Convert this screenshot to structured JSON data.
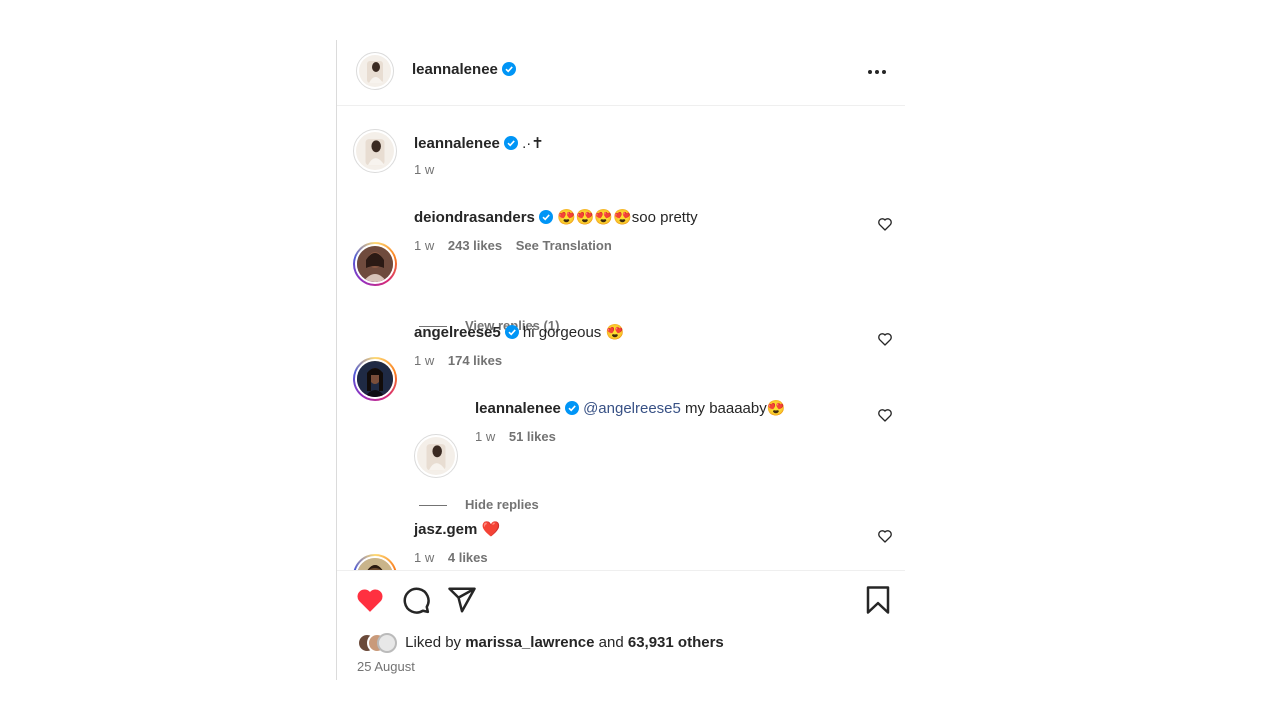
{
  "header": {
    "username": "leannalenee"
  },
  "caption": {
    "username": "leannalenee",
    "text": ".·✝",
    "time": "1 w"
  },
  "comments": [
    {
      "username": "deiondrasanders",
      "text": "😍😍😍😍soo pretty",
      "time": "1 w",
      "likes": "243 likes",
      "translate": "See Translation",
      "replies_label": "View replies (1)"
    },
    {
      "username": "angelreese5",
      "text": "hi gorgeous 😍",
      "time": "1 w",
      "likes": "174 likes"
    },
    {
      "username": "jasz.gem",
      "text": "❤️",
      "time": "1 w",
      "likes": "4 likes"
    }
  ],
  "reply": {
    "username": "leannalenee",
    "mention": "@angelreese5",
    "text": " my baaaaby😍",
    "time": "1 w",
    "likes": "51 likes",
    "hide_label": "Hide replies"
  },
  "footer": {
    "liked_prefix": "Liked by ",
    "liked_user": "marissa_lawrence",
    "liked_mid": " and ",
    "liked_count": "63,931 others",
    "date": "25 August"
  },
  "colors": {
    "verified": "#0095f6",
    "like_red": "#ff3040",
    "mention": "#385185"
  }
}
